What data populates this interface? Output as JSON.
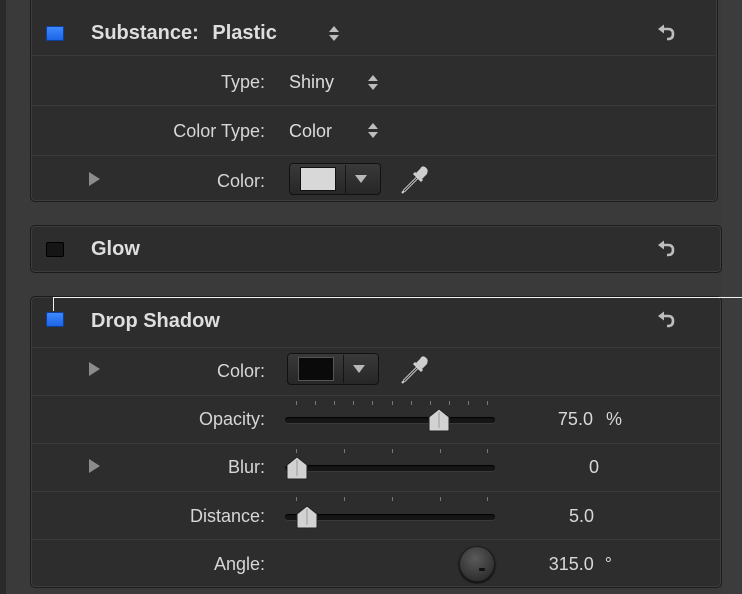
{
  "substance": {
    "title": "Substance:",
    "value": "Plastic",
    "enabled": true,
    "rows": {
      "type": {
        "label": "Type:",
        "value": "Shiny"
      },
      "color_type": {
        "label": "Color Type:",
        "value": "Color"
      },
      "color": {
        "label": "Color:",
        "swatch": "#d8d8d8"
      }
    }
  },
  "glow": {
    "title": "Glow",
    "enabled": false
  },
  "drop_shadow": {
    "title": "Drop Shadow",
    "enabled": true,
    "rows": {
      "color": {
        "label": "Color:",
        "swatch": "#0a0a0a"
      },
      "opacity": {
        "label": "Opacity:",
        "value": "75.0",
        "unit": "%",
        "level": 0.75
      },
      "blur": {
        "label": "Blur:",
        "value": "0",
        "level": 0.0
      },
      "distance": {
        "label": "Distance:",
        "value": "5.0",
        "level": 0.05
      },
      "angle": {
        "label": "Angle:",
        "value": "315.0",
        "unit": "°"
      }
    }
  },
  "colors": {
    "accent": "#2f7bf5",
    "panel": "#2d2d2e"
  },
  "icons": {
    "reset": "reset-arrow-icon",
    "eyedropper": "eyedropper-icon",
    "disclosure": "disclosure-triangle-icon"
  }
}
